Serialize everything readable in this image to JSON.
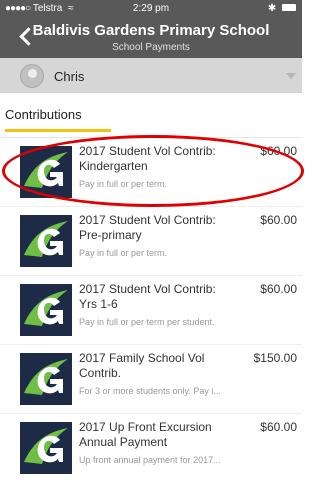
{
  "status_bar": {
    "carrier": "Telstra",
    "time": "2:29 pm",
    "bluetooth": "✱"
  },
  "header": {
    "title": "Baldivis Gardens Primary School",
    "subtitle": "School Payments"
  },
  "user": {
    "name": "Chris"
  },
  "tab": {
    "label": "Contributions"
  },
  "items": [
    {
      "title": "2017 Student Vol Contrib: Kindergarten",
      "price": "$60.00",
      "desc": "Pay in full or per term."
    },
    {
      "title": "2017 Student Vol Contrib: Pre-primary",
      "price": "$60.00",
      "desc": "Pay in full or per term."
    },
    {
      "title": "2017 Student Vol Contrib: Yrs 1-6",
      "price": "$60.00",
      "desc": "Pay in full or per term per student."
    },
    {
      "title": "2017 Family School Vol Contrib.",
      "price": "$150.00",
      "desc": "For 3 or more students only. Pay i..."
    },
    {
      "title": "2017 Up Front Excursion Annual Payment",
      "price": "$60.00",
      "desc": "Up front annual payment for 2017..."
    }
  ]
}
